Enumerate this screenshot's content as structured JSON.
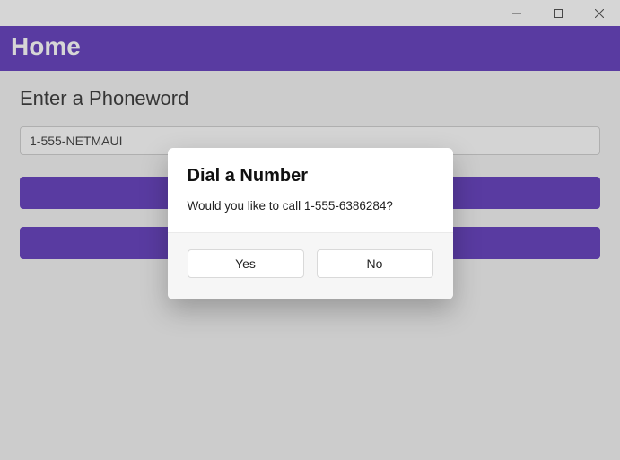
{
  "window": {
    "icons": {
      "minimize": "minimize",
      "maximize": "maximize",
      "close": "close"
    }
  },
  "header": {
    "title": "Home"
  },
  "main": {
    "prompt_label": "Enter a Phoneword",
    "phone_value": "1-555-NETMAUI",
    "translate_label": "",
    "call_label": ""
  },
  "dialog": {
    "title": "Dial a Number",
    "message": "Would you like to call 1-555-6386284?",
    "yes_label": "Yes",
    "no_label": "No"
  }
}
